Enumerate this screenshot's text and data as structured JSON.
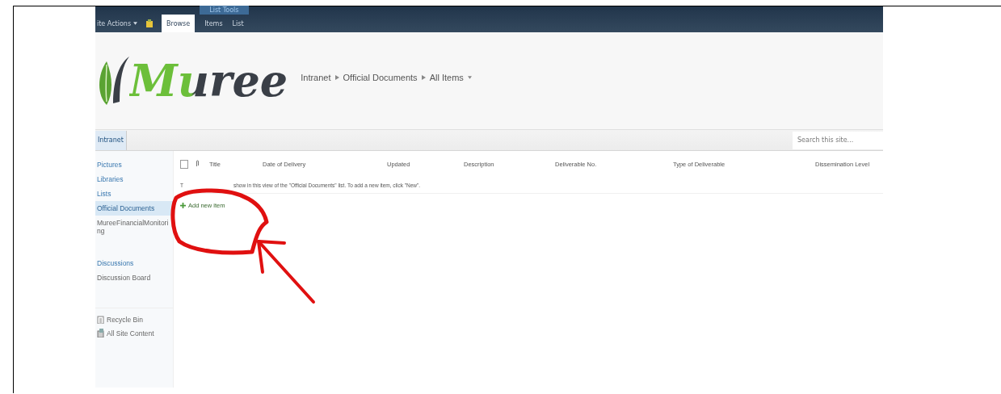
{
  "ribbon": {
    "site_actions": "ite Actions",
    "tab_group": "List Tools",
    "tabs": [
      {
        "label": "Browse",
        "selected": true
      },
      {
        "label": "Items",
        "selected": false
      },
      {
        "label": "List",
        "selected": false
      }
    ]
  },
  "header": {
    "logo": "Muree",
    "breadcrumb": [
      "Intranet",
      "Official Documents",
      "All Items"
    ]
  },
  "top_nav": {
    "tabs": [
      {
        "label": "Intranet",
        "selected": true
      }
    ],
    "search": {
      "placeholder": "Search this site..."
    }
  },
  "sidebar": {
    "groups": [
      {
        "items": [
          {
            "label": "Pictures",
            "kind": "heading",
            "selected": false
          },
          {
            "label": "Libraries",
            "kind": "heading",
            "selected": false
          },
          {
            "label": "Lists",
            "kind": "heading",
            "selected": false
          },
          {
            "label": "Official Documents",
            "kind": "link",
            "selected": true
          },
          {
            "label": "MureeFinancialMonitoring",
            "kind": "link",
            "selected": false
          }
        ]
      },
      {
        "items": [
          {
            "label": "Discussions",
            "kind": "heading",
            "selected": false
          },
          {
            "label": "Discussion Board",
            "kind": "link",
            "selected": false
          }
        ]
      }
    ],
    "bottom_links": [
      {
        "label": "Recycle Bin",
        "kind": "recycle"
      },
      {
        "label": "All Site Content",
        "kind": "content"
      }
    ]
  },
  "list": {
    "select_all": {
      "checked": false
    },
    "columns": [
      "Title",
      "Date of Delivery",
      "Updated",
      "Description",
      "Deliverable No.",
      "Type of Deliverable",
      "Dissemination Level"
    ],
    "empty_message_start": "T",
    "empty_message": "show in this view of the \"Official Documents\" list. To add a new item, click \"New\".",
    "add_link": "Add new item"
  }
}
